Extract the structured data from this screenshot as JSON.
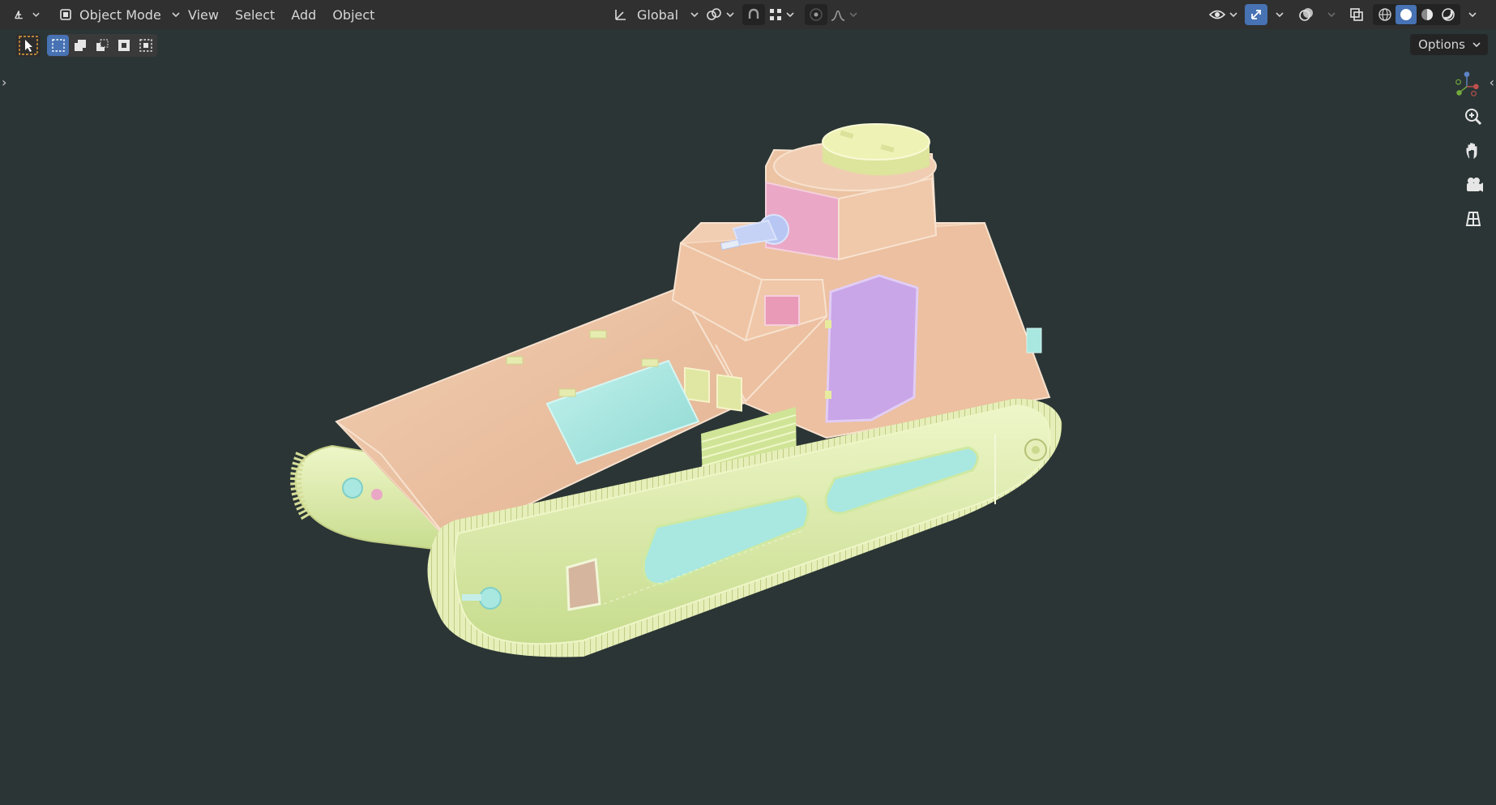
{
  "header": {
    "mode_label": "Object Mode",
    "menus": [
      "View",
      "Select",
      "Add",
      "Object"
    ],
    "transform_orientation": "Global"
  },
  "toolbar": {
    "options_label": "Options"
  },
  "icons": {
    "editor_type": "editor-type-icon",
    "object_mode": "object-mode-icon",
    "select_tool": "select-cursor-icon",
    "select_box": "select-box-icon",
    "select_extend": "select-extend-icon",
    "select_subtract": "select-subtract-icon",
    "select_invert": "select-invert-icon",
    "select_intersect": "select-intersect-icon",
    "orientation": "transform-orientation-icon",
    "pivot": "pivot-point-icon",
    "snap": "snap-icon",
    "snap_increment": "snap-increment-icon",
    "proportional": "proportional-editing-icon",
    "falloff": "falloff-curve-icon",
    "visibility": "visibility-eye-icon",
    "gizmo": "gizmo-icon",
    "overlay": "overlay-icon",
    "xray": "xray-icon",
    "shading_wire": "shading-wireframe-icon",
    "shading_solid": "shading-solid-icon",
    "shading_material": "shading-material-icon",
    "shading_render": "shading-rendered-icon",
    "zoom": "zoom-icon",
    "pan": "pan-hand-icon",
    "camera": "camera-icon",
    "ortho": "ortho-grid-icon"
  },
  "colors": {
    "viewport_bg": "#2b3535",
    "header_bg": "#303030",
    "active_blue": "#4772b3",
    "track_green": "#d8e9a8",
    "hull_peach": "#ecc4a4",
    "turret_top_yellow": "#e9ecaa",
    "cyan_panel": "#a9e7e1",
    "purple_door": "#c9a6e8",
    "pink_panel": "#eaa8c6",
    "gun_blue": "#b7c6f2"
  }
}
